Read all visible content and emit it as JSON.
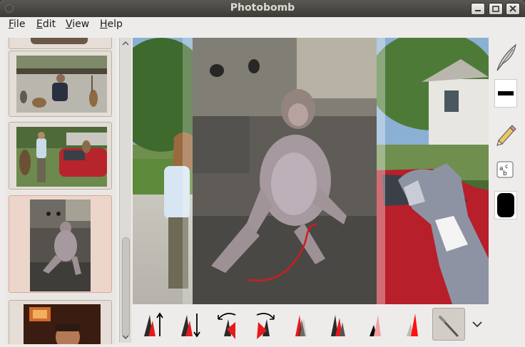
{
  "window": {
    "title": "Photobomb"
  },
  "menu": {
    "items": [
      {
        "label": "File",
        "mnemonic": "F",
        "rest": "ile"
      },
      {
        "label": "Edit",
        "mnemonic": "E",
        "rest": "dit"
      },
      {
        "label": "View",
        "mnemonic": "V",
        "rest": "iew"
      },
      {
        "label": "Help",
        "mnemonic": "H",
        "rest": "elp"
      }
    ]
  },
  "sidebar": {
    "thumbnails": [
      {
        "name": "partial-top-photo"
      },
      {
        "name": "man-with-monkeys-photo"
      },
      {
        "name": "woman-monkey-car-photo"
      },
      {
        "name": "monkey-on-stone-photo",
        "selected": true
      },
      {
        "name": "man-portrait-photo"
      }
    ]
  },
  "tools": {
    "right": [
      "feather-icon",
      "line-width-icon",
      "pencil-icon",
      "text-abc-icon",
      "color-swatch-icon"
    ],
    "bottom": [
      "raise-layer-icon",
      "lower-layer-icon",
      "rotate-left-icon",
      "rotate-right-icon",
      "flip-horizontal-icon",
      "flip-vertical-icon",
      "darken-icon",
      "lighten-icon",
      "brush-tool-icon"
    ]
  },
  "colors": {
    "titlebar": "#3c3b37",
    "title_text": "#dfdbd2",
    "selection": "#ecd6cb",
    "stroke_red": "#cc1e1e",
    "swatch": "#000000"
  }
}
